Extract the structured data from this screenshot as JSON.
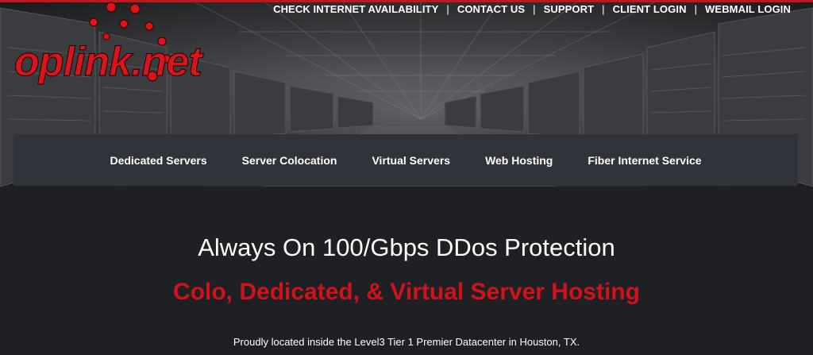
{
  "top_nav": {
    "items": [
      {
        "label": "CHECK INTERNET AVAILABILITY"
      },
      {
        "label": "CONTACT US"
      },
      {
        "label": "SUPPORT"
      },
      {
        "label": "CLIENT LOGIN"
      },
      {
        "label": "WEBMAIL LOGIN"
      }
    ],
    "separator": "|"
  },
  "logo": {
    "text": "oplink.net",
    "brand_color": "#d9151b"
  },
  "main_nav": {
    "items": [
      {
        "label": "Dedicated Servers"
      },
      {
        "label": "Server Colocation"
      },
      {
        "label": "Virtual Servers"
      },
      {
        "label": "Web Hosting"
      },
      {
        "label": "Fiber Internet Service"
      }
    ]
  },
  "content": {
    "headline": "Always On 100/Gbps DDos Protection",
    "subheadline": "Colo, Dedicated, & Virtual Server Hosting",
    "location": "Proudly located inside the Level3 Tier 1 Premier Datacenter in Houston, TX."
  },
  "colors": {
    "accent_red": "#d0121a",
    "nav_bar": "#30333a",
    "page_bg": "#1f2024"
  }
}
